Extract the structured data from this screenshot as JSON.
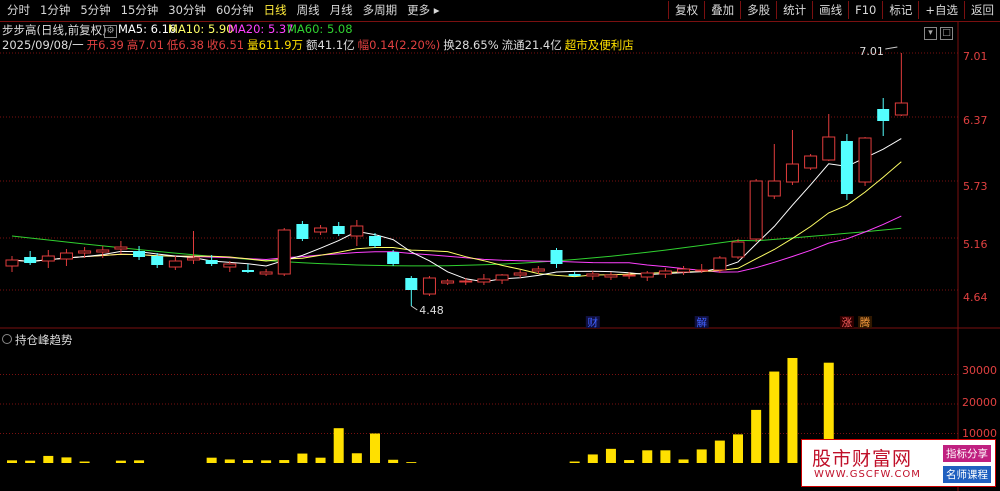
{
  "toolbar": {
    "periods": [
      "分时",
      "1分钟",
      "5分钟",
      "15分钟",
      "30分钟",
      "60分钟",
      "日线",
      "周线",
      "月线",
      "多周期",
      "更多"
    ],
    "active_period": "日线",
    "right_buttons": [
      "复权",
      "叠加",
      "多股",
      "统计",
      "画线",
      "F10",
      "标记",
      "+自选",
      "返回"
    ]
  },
  "header": {
    "title": "步步高(日线,前复权)",
    "ma5": "MA5: 6.16",
    "ma10": "MA10: 5.90",
    "ma20": "MA20: 5.37",
    "ma60": "MA60: 5.08"
  },
  "quote": {
    "date": "2025/09/08/一",
    "open": "开6.39",
    "high": "高7.01",
    "low": "低6.38",
    "close": "收6.51",
    "volume": "量611.9万",
    "amount": "额41.1亿",
    "change": "幅0.14(2.20%)",
    "turnover": "换28.65%",
    "float": "流通21.4亿",
    "sector": "超市及便利店"
  },
  "price_axis": [
    "7.01",
    "6.37",
    "5.73",
    "5.16",
    "4.64"
  ],
  "annotations": {
    "high": "7.01",
    "low": "4.48"
  },
  "markers": [
    "财",
    "解",
    "涨",
    "腾"
  ],
  "volume_panel": {
    "title": "持仓峰趋势",
    "axis": [
      "30000",
      "20000",
      "10000"
    ]
  },
  "colors": {
    "up": "#e03c3c",
    "down": "#54ffff",
    "ma5": "#ffffff",
    "ma10": "#ffff66",
    "ma20": "#ff40ff",
    "ma60": "#30d030",
    "volume": "#ffe000",
    "grid": "#7a1010"
  },
  "chart_data": {
    "type": "candlestick",
    "ylim": [
      4.4,
      7.1
    ],
    "candles": [
      {
        "o": 4.88,
        "h": 4.98,
        "l": 4.82,
        "c": 4.94
      },
      {
        "o": 4.97,
        "h": 5.03,
        "l": 4.89,
        "c": 4.91
      },
      {
        "o": 4.93,
        "h": 5.04,
        "l": 4.86,
        "c": 4.98
      },
      {
        "o": 4.95,
        "h": 5.05,
        "l": 4.88,
        "c": 5.01
      },
      {
        "o": 5.01,
        "h": 5.07,
        "l": 4.96,
        "c": 5.03
      },
      {
        "o": 5.02,
        "h": 5.08,
        "l": 4.96,
        "c": 5.04
      },
      {
        "o": 5.05,
        "h": 5.13,
        "l": 5.0,
        "c": 5.07
      },
      {
        "o": 5.03,
        "h": 5.08,
        "l": 4.94,
        "c": 4.97
      },
      {
        "o": 4.98,
        "h": 5.01,
        "l": 4.86,
        "c": 4.89
      },
      {
        "o": 4.87,
        "h": 4.98,
        "l": 4.84,
        "c": 4.93
      },
      {
        "o": 4.94,
        "h": 5.23,
        "l": 4.9,
        "c": 4.96
      },
      {
        "o": 4.94,
        "h": 4.99,
        "l": 4.88,
        "c": 4.9
      },
      {
        "o": 4.87,
        "h": 4.93,
        "l": 4.82,
        "c": 4.9
      },
      {
        "o": 4.84,
        "h": 4.9,
        "l": 4.81,
        "c": 4.82
      },
      {
        "o": 4.8,
        "h": 4.85,
        "l": 4.78,
        "c": 4.82
      },
      {
        "o": 4.8,
        "h": 5.26,
        "l": 4.78,
        "c": 5.24
      },
      {
        "o": 5.3,
        "h": 5.33,
        "l": 5.13,
        "c": 5.15
      },
      {
        "o": 5.22,
        "h": 5.29,
        "l": 5.19,
        "c": 5.26
      },
      {
        "o": 5.28,
        "h": 5.32,
        "l": 5.18,
        "c": 5.2
      },
      {
        "o": 5.18,
        "h": 5.34,
        "l": 5.08,
        "c": 5.28
      },
      {
        "o": 5.18,
        "h": 5.21,
        "l": 5.06,
        "c": 5.08
      },
      {
        "o": 5.02,
        "h": 5.04,
        "l": 4.88,
        "c": 4.9
      },
      {
        "o": 4.76,
        "h": 4.78,
        "l": 4.48,
        "c": 4.64
      },
      {
        "o": 4.6,
        "h": 4.78,
        "l": 4.58,
        "c": 4.76
      },
      {
        "o": 4.71,
        "h": 4.75,
        "l": 4.69,
        "c": 4.73
      },
      {
        "o": 4.72,
        "h": 4.76,
        "l": 4.69,
        "c": 4.73
      },
      {
        "o": 4.72,
        "h": 4.8,
        "l": 4.69,
        "c": 4.75
      },
      {
        "o": 4.74,
        "h": 4.8,
        "l": 4.7,
        "c": 4.79
      },
      {
        "o": 4.79,
        "h": 4.84,
        "l": 4.76,
        "c": 4.81
      },
      {
        "o": 4.83,
        "h": 4.88,
        "l": 4.8,
        "c": 4.85
      },
      {
        "o": 5.04,
        "h": 5.06,
        "l": 4.86,
        "c": 4.9
      },
      {
        "o": 4.8,
        "h": 4.82,
        "l": 4.77,
        "c": 4.78
      },
      {
        "o": 4.78,
        "h": 4.83,
        "l": 4.74,
        "c": 4.8
      },
      {
        "o": 4.77,
        "h": 4.82,
        "l": 4.74,
        "c": 4.79
      },
      {
        "o": 4.78,
        "h": 4.82,
        "l": 4.75,
        "c": 4.79
      },
      {
        "o": 4.77,
        "h": 4.83,
        "l": 4.73,
        "c": 4.81
      },
      {
        "o": 4.8,
        "h": 4.86,
        "l": 4.76,
        "c": 4.83
      },
      {
        "o": 4.82,
        "h": 4.88,
        "l": 4.79,
        "c": 4.85
      },
      {
        "o": 4.84,
        "h": 4.9,
        "l": 4.81,
        "c": 4.84
      },
      {
        "o": 4.84,
        "h": 4.98,
        "l": 4.81,
        "c": 4.96
      },
      {
        "o": 4.97,
        "h": 5.15,
        "l": 4.95,
        "c": 5.12
      },
      {
        "o": 5.15,
        "h": 5.75,
        "l": 5.12,
        "c": 5.73
      },
      {
        "o": 5.58,
        "h": 6.1,
        "l": 5.55,
        "c": 5.73
      },
      {
        "o": 5.72,
        "h": 6.24,
        "l": 5.69,
        "c": 5.9
      },
      {
        "o": 5.86,
        "h": 6.0,
        "l": 5.84,
        "c": 5.98
      },
      {
        "o": 5.94,
        "h": 6.4,
        "l": 5.93,
        "c": 6.17
      },
      {
        "o": 6.13,
        "h": 6.2,
        "l": 5.54,
        "c": 5.6
      },
      {
        "o": 5.72,
        "h": 6.17,
        "l": 5.68,
        "c": 6.16
      },
      {
        "o": 6.45,
        "h": 6.56,
        "l": 6.18,
        "c": 6.33
      },
      {
        "o": 6.39,
        "h": 7.01,
        "l": 6.38,
        "c": 6.51
      }
    ],
    "volume_ylim": [
      0,
      40000
    ],
    "volume": [
      900,
      800,
      2400,
      1900,
      500,
      800,
      900,
      0,
      0,
      0,
      1800,
      1200,
      1000,
      900,
      1000,
      3200,
      1800,
      11800,
      3300,
      10000,
      1100,
      300,
      0,
      0,
      0,
      0,
      0,
      0,
      0,
      0,
      500,
      2900,
      4800,
      1000,
      4300,
      4300,
      1200,
      4600,
      7600,
      9700,
      18000,
      31000,
      35600,
      0,
      34000,
      6000,
      0,
      0,
      0,
      0
    ],
    "vol_positions": [
      0,
      1,
      2,
      3,
      4,
      6,
      7,
      8,
      9,
      10,
      11,
      12,
      13,
      14,
      15,
      16,
      17,
      18,
      19,
      20,
      21,
      22,
      23,
      24,
      25,
      26,
      27,
      28,
      29,
      30,
      31,
      32,
      33,
      34,
      35,
      36,
      37,
      38,
      39,
      40,
      41,
      42,
      43,
      44,
      45,
      46,
      47,
      48,
      49,
      50
    ]
  }
}
